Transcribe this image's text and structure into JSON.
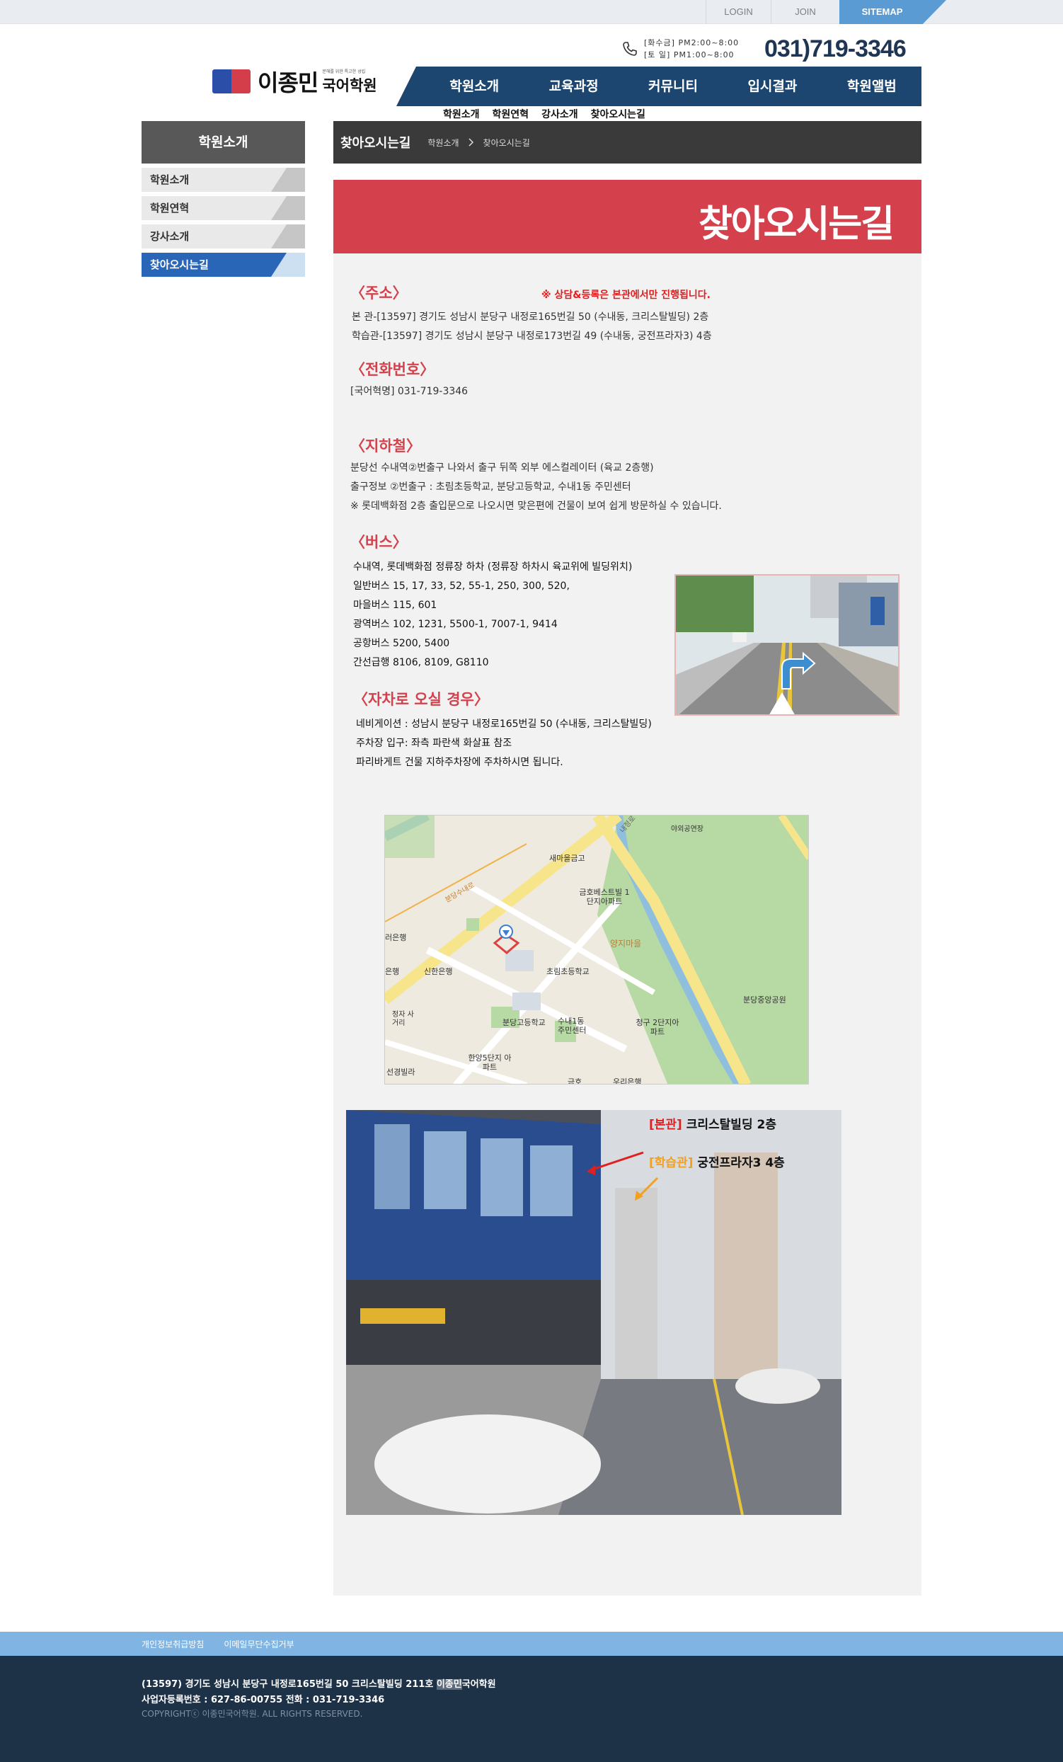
{
  "topbar": {
    "login": "LOGIN",
    "join": "JOIN",
    "sitemap": "SITEMAP"
  },
  "brand": {
    "tagline": "문해를 위한 특고한 성립",
    "name": "이종민",
    "academy": "국어학원"
  },
  "contact": {
    "hours_weekday": "[화수금] PM2:00~8:00",
    "hours_saturday": "[토  일] PM1:00~8:00",
    "phone": "031)719-3346"
  },
  "gnb": [
    "학원소개",
    "교육과정",
    "커뮤니티",
    "입시결과",
    "학원앨범"
  ],
  "subnav": [
    "학원소개",
    "학원연혁",
    "강사소개",
    "찾아오시는길"
  ],
  "lnb": {
    "title": "학원소개",
    "items": [
      "학원소개",
      "학원연혁",
      "강사소개",
      "찾아오시는길"
    ]
  },
  "breadcrumb": {
    "title": "찾아오시는길",
    "home": "학원소개",
    "current": "찾아오시는길"
  },
  "banner_title": "찾아오시는길",
  "address": {
    "heading": "〈주소〉",
    "notice": "※ 상담&등록은 본관에서만 진행됩니다.",
    "main": "본 관-[13597] 경기도 성남시 분당구 내정로165번길 50 (수내동, 크리스탈빌딩) 2층",
    "study": "학습관-[13597] 경기도 성남시 분당구 내정로173번길 49 (수내동, 궁전프라자3) 4층"
  },
  "phone_section": {
    "heading": "〈전화번호〉",
    "line": "[국어혁명] 031-719-3346"
  },
  "subway": {
    "heading": "〈지하철〉",
    "lines": [
      "분당선 수내역②번출구 나와서 출구 뒤쪽 외부 에스컬레이터 (육교 2층행)",
      "출구정보 ②번출구 : 초림초등학교, 분당고등학교, 수내1동 주민센터",
      "※ 롯데백화점 2층 출입문으로 나오시면 맞은편에 건물이 보여 쉽게 방문하실 수 있습니다."
    ]
  },
  "bus": {
    "heading": "〈버스〉",
    "lines": [
      "수내역, 롯데백화점 정류장 하차 (정류장 하차시 육교위에 빌딩위치)",
      "일반버스 15, 17, 33, 52, 55-1, 250, 300, 520,",
      "마을버스 115, 601",
      "광역버스 102, 1231, 5500-1, 7007-1, 9414",
      "공항버스 5200, 5400",
      "간선급행 8106, 8109, G8110"
    ]
  },
  "car": {
    "heading": "〈자차로 오실 경우〉",
    "lines": [
      "네비게이션 : 성남시 분당구 내정로165번길 50 (수내동, 크리스탈빌딩)",
      "주차장 입구: 좌측 파란색 화살표 참조",
      "파리바게트 건물 지하주차장에 주차하시면 됩니다."
    ]
  },
  "map_labels": {
    "l1": "새마을금고",
    "l2": "금호베스트빌 1단지아파트",
    "l3": "양지마을",
    "l4": "초림초등학교",
    "l5": "신한은행",
    "l6": "분당고등학교",
    "l7": "수내1동 주민센터",
    "l8": "청구 2단지아파트",
    "l9": "한양5단지 아파트",
    "l10": "분당중앙공원",
    "l11": "야외공연장",
    "l12": "정자 사거리",
    "l13": "선경빌라",
    "l14": "우리은행",
    "l15": "금호",
    "l16": "러은행",
    "l17": "은행",
    "l18": "분당수내로",
    "l19": "내정로"
  },
  "photo_labels": {
    "main_tag": "[본관]",
    "main_text": "크리스탈빌딩 2층",
    "study_tag": "[학습관]",
    "study_text": "궁전프라자3 4층"
  },
  "footer": {
    "links": [
      "개인정보취급방침",
      "이메일무단수집거부"
    ],
    "address_pre": "(13597) 경기도 성남시 분당구 내정로165번길 50 크리스탈빌딩 211호 ",
    "address_hl": "이종민",
    "address_post": "국어학원",
    "business": "사업자등록번호 : 627-86-00755 전화 : 031-719-3346",
    "copyright": "COPYRIGHTⓒ 이종민국어학원. ALL RIGHTS RESERVED."
  },
  "colors": {
    "accent_red": "#d4404b",
    "nav_blue": "#1c4670",
    "active_blue": "#2a66b8",
    "footer_dark": "#1d3147",
    "footer_light": "#7fb4e3"
  }
}
